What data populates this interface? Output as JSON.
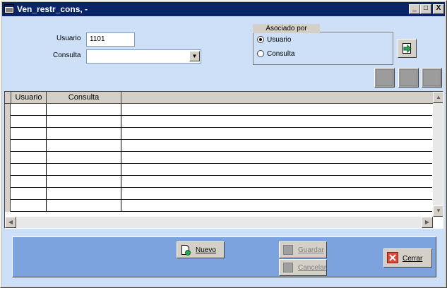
{
  "window": {
    "title": "Ven_restr_cons, -",
    "minimize_glyph": "_",
    "maximize_glyph": "□",
    "close_glyph": "X"
  },
  "form": {
    "usuario_label": "Usuario",
    "usuario_value": "1101",
    "consulta_label": "Consulta",
    "consulta_value": ""
  },
  "associated": {
    "title": "Asociado por",
    "options": [
      {
        "label": "Usuario",
        "selected": true
      },
      {
        "label": "Consulta",
        "selected": false
      }
    ]
  },
  "grid": {
    "columns": [
      "Usuario",
      "Consulta"
    ],
    "rows": 9
  },
  "buttons": {
    "nuevo": "Nuevo",
    "guardar": "Guardar",
    "cancelar": "Cancelar",
    "cerrar": "Cerrar"
  }
}
